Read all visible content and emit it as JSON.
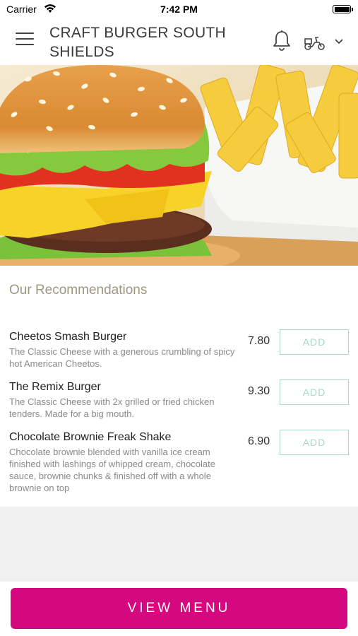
{
  "status_bar": {
    "carrier": "Carrier",
    "time": "7:42 PM"
  },
  "header": {
    "title": "CRAFT BURGER SOUTH SHIELDS"
  },
  "recommendations": {
    "heading": "Our Recommendations",
    "items": [
      {
        "name": "Cheetos Smash Burger",
        "description": "The Classic Cheese with a generous crumbling of spicy hot American Cheetos.",
        "price": "7.80",
        "add_label": "ADD"
      },
      {
        "name": "The Remix Burger",
        "description": "The Classic Cheese with 2x grilled or fried chicken tenders. Made for a big mouth.",
        "price": "9.30",
        "add_label": "ADD"
      },
      {
        "name": "Chocolate Brownie Freak Shake",
        "description": "Chocolate brownie blended with vanilla ice cream finished with lashings of whipped cream, chocolate sauce, brownie chunks & finished off with a whole brownie on top",
        "price": "6.90",
        "add_label": "ADD"
      }
    ]
  },
  "footer": {
    "view_menu_label": "VIEW MENU"
  },
  "colors": {
    "brand_magenta": "#d4087f",
    "add_outline": "#a9d9c4",
    "heading_tan": "#a09680"
  },
  "icons": {
    "menu": "hamburger-menu-icon",
    "notifications": "bell-icon",
    "delivery": "scooter-icon",
    "dropdown": "chevron-down-icon"
  }
}
